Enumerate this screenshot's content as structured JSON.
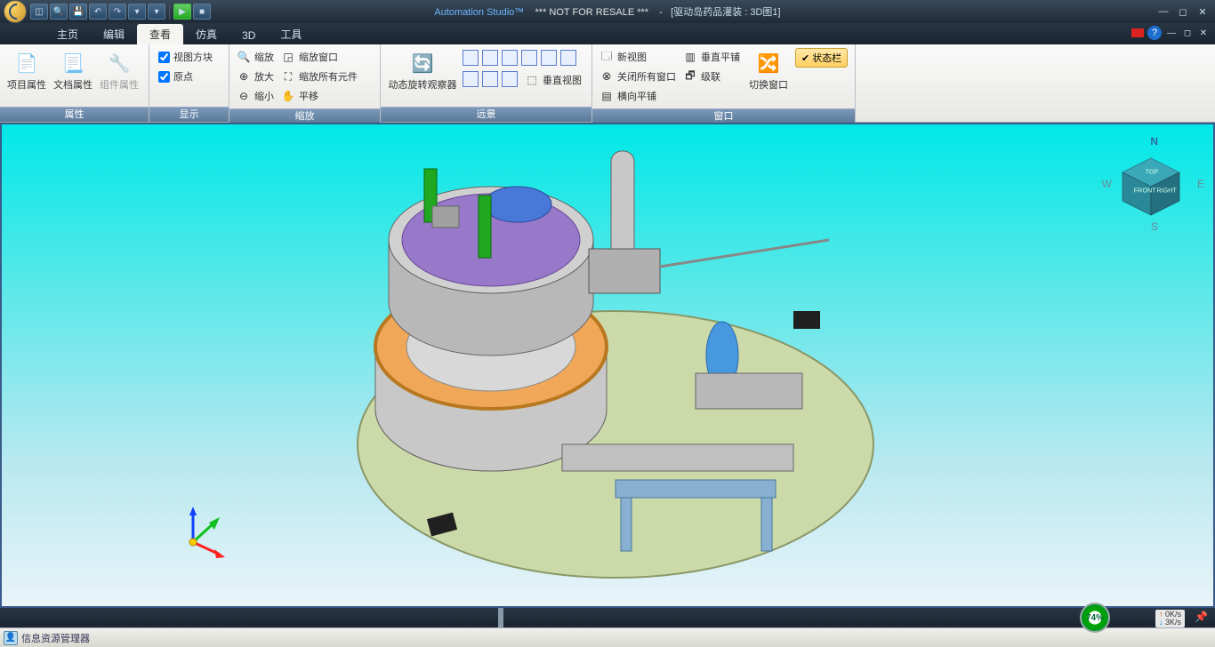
{
  "title": {
    "app": "Automation Studio™",
    "not_for_resale": "*** NOT FOR RESALE ***",
    "sep": "-",
    "doc": "[驱动岛药品灌装 : 3D图1]"
  },
  "qat": [
    "new",
    "open",
    "save",
    "undo",
    "redo",
    "dd1",
    "dd2",
    "play",
    "stop"
  ],
  "tabs": {
    "items": [
      "主页",
      "编辑",
      "查看",
      "仿真",
      "3D",
      "工具"
    ],
    "active": 2
  },
  "ribbon": {
    "groups": {
      "props": {
        "title": "属性",
        "btns": {
          "proj": "项目属性",
          "doc": "文档属性",
          "comp": "组件属性"
        }
      },
      "display": {
        "title": "显示",
        "chks": {
          "viewcube": "视图方块",
          "origin": "原点"
        }
      },
      "zoom": {
        "title": "缩放",
        "btns": {
          "fit": "缩放",
          "window": "缩放窗口",
          "in": "放大",
          "all": "缩放所有元件",
          "out": "缩小",
          "pan": "平移"
        }
      },
      "view3d": {
        "title": "远景",
        "orbit": "动态旋转观察器",
        "ortho": "垂直视图"
      },
      "window": {
        "title": "窗口",
        "new": "新视图",
        "closeall": "关闭所有窗口",
        "tileh": "横向平铺",
        "tilev": "垂直平铺",
        "cascade": "级联",
        "switch": "切换窗口",
        "status": "状态栏"
      }
    }
  },
  "viewcube": {
    "front": "FRONT",
    "right": "RIGHT",
    "top": "TOP"
  },
  "compass": {
    "n": "N",
    "s": "S",
    "e": "E",
    "w": "W"
  },
  "status": {
    "gauge": "74%",
    "up": "0K/s",
    "down": "3K/s"
  },
  "bottom": {
    "explorer": "信息资源管理器"
  }
}
